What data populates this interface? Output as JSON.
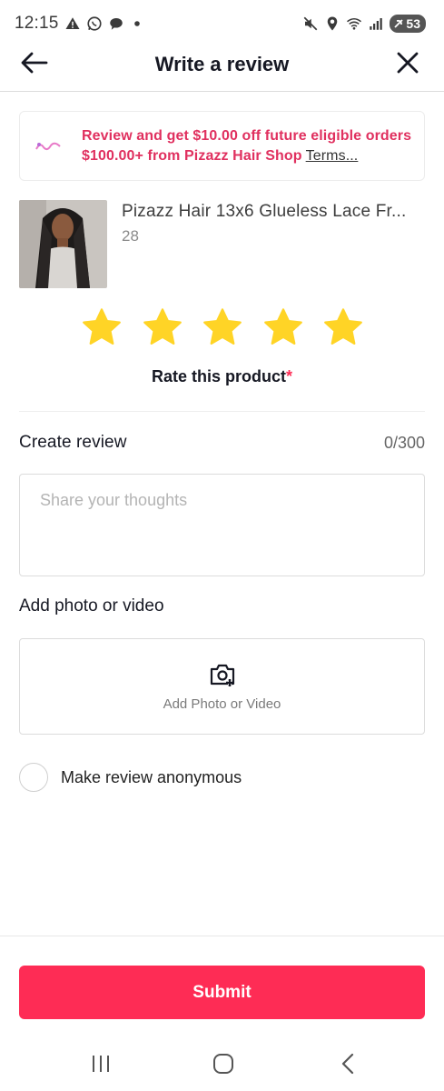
{
  "status_bar": {
    "time": "12:15",
    "battery": "53"
  },
  "header": {
    "title": "Write a review"
  },
  "promo": {
    "text": "Review and get $10.00 off future eligible orders $100.00+ from Pizazz Hair Shop",
    "terms": "Terms..."
  },
  "product": {
    "name": "Pizazz Hair 13x6 Glueless Lace Fr...",
    "variant": "28"
  },
  "rating": {
    "stars_selected": 5,
    "stars_total": 5,
    "label": "Rate this product",
    "required_mark": "*",
    "star_color": "#FFD426"
  },
  "review": {
    "title": "Create review",
    "char_count": "0/300",
    "placeholder": "Share your thoughts"
  },
  "media": {
    "title": "Add photo or video",
    "button_label": "Add Photo or Video"
  },
  "anonymous": {
    "label": "Make review anonymous",
    "checked": false
  },
  "submit": {
    "label": "Submit",
    "color": "#FE2C55"
  }
}
